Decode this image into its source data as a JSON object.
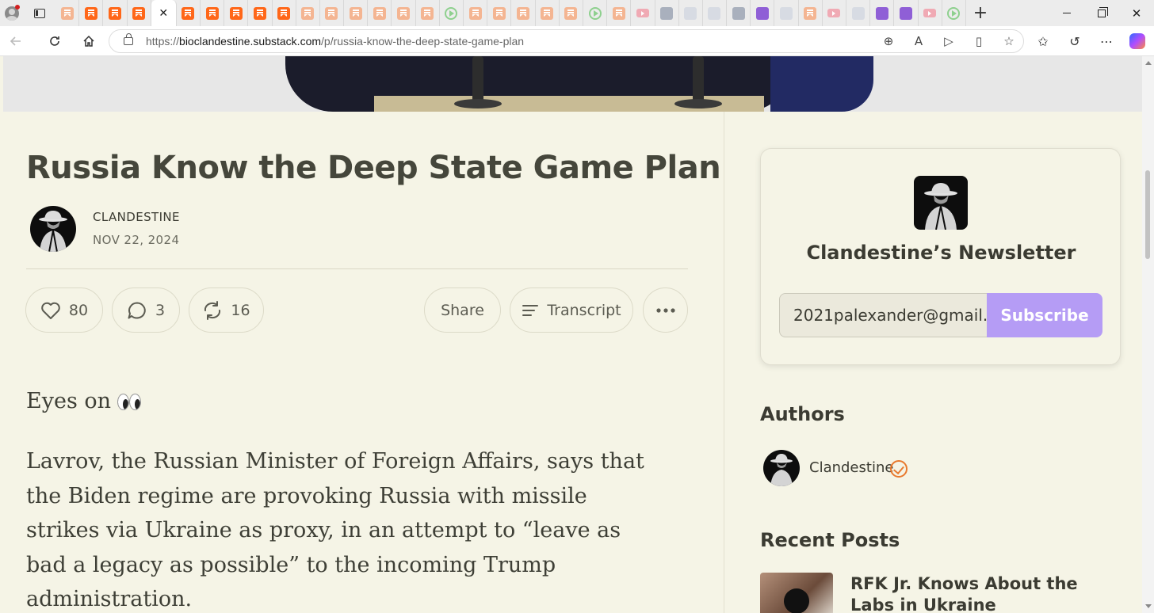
{
  "browser": {
    "url_domain": "bioclandestine.substack.com",
    "url_path": "/p/russia-know-the-deep-state-game-plan",
    "url_scheme": "https://",
    "close_tab_glyph": "✕",
    "new_tab_glyph": "+",
    "tab_icons": [
      "substack-pale",
      "substack",
      "substack",
      "substack",
      "active",
      "substack",
      "substack",
      "substack",
      "substack",
      "substack",
      "substack-pale",
      "substack-pale",
      "substack-pale",
      "substack-pale",
      "substack-pale",
      "substack-pale",
      "play",
      "substack-pale",
      "substack-pale",
      "substack-pale",
      "substack-pale",
      "substack-pale",
      "play",
      "substack-pale",
      "youtube",
      "news",
      "translate",
      "search",
      "dr",
      "yahoo",
      "gp",
      "substack-pale",
      "youtube",
      "grid",
      "yahoo",
      "yahoo",
      "youtube",
      "play"
    ],
    "window_controls": [
      "minimize",
      "maximize",
      "close"
    ]
  },
  "post": {
    "title": "Russia Know the Deep State Game Plan",
    "author": "CLANDESTINE",
    "date": "NOV 22, 2024",
    "likes": "80",
    "comments": "3",
    "restacks": "16",
    "share_label": "Share",
    "transcript_label": "Transcript",
    "paragraph1": "Eyes on",
    "paragraph2": "Lavrov, the Russian Minister of Foreign Affairs, says that the Biden regime are provoking Russia with missile strikes via Ukraine as proxy, in an attempt to “leave as bad a legacy as possible” to the incoming Trump administration."
  },
  "sidebar": {
    "newsletter_name": "Clandestine’s Newsletter",
    "email_value": "2021palexander@gmail.",
    "subscribe_label": "Subscribe",
    "authors_heading": "Authors",
    "author_name": "Clandestine",
    "recent_heading": "Recent Posts",
    "recent_post_title": "RFK Jr. Knows About the Labs in Ukraine"
  },
  "colors": {
    "page_bg": "#f5f4e6",
    "subscribe_bg": "#b59cf5",
    "verified": "#e87a2f",
    "substack_orange": "#ff6719"
  }
}
